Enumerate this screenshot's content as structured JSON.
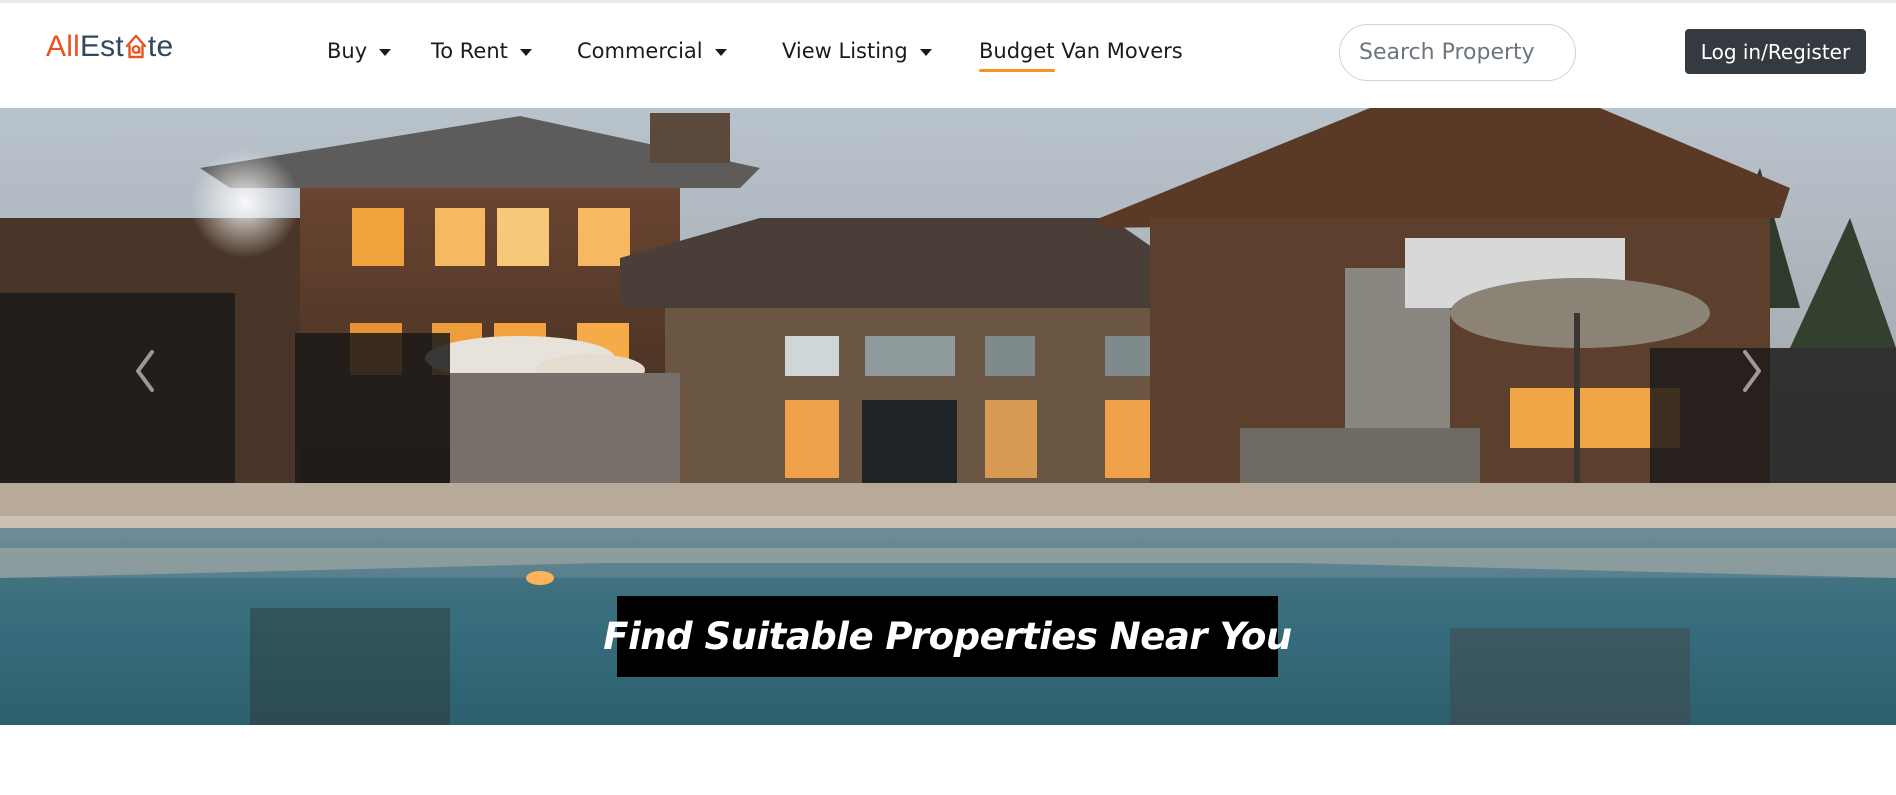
{
  "logo": {
    "part1": "All",
    "part2": "Est",
    "part3": "te",
    "icon": "house-a-icon"
  },
  "nav": {
    "buy": "Buy",
    "to_rent": "To Rent",
    "commercial": "Commercial",
    "view_listing": "View Listing",
    "budget_van_movers": "Budget Van Movers"
  },
  "search": {
    "placeholder": "Search Property"
  },
  "auth": {
    "login_label": "Log in/Register"
  },
  "hero": {
    "caption": "Find Suitable Properties Near You",
    "prev_icon": "chevron-left-icon",
    "next_icon": "chevron-right-icon"
  },
  "colors": {
    "brand_orange": "#e8541f",
    "brand_navy": "#2f4760",
    "active_underline": "#f7941d",
    "login_bg": "#343a40"
  }
}
